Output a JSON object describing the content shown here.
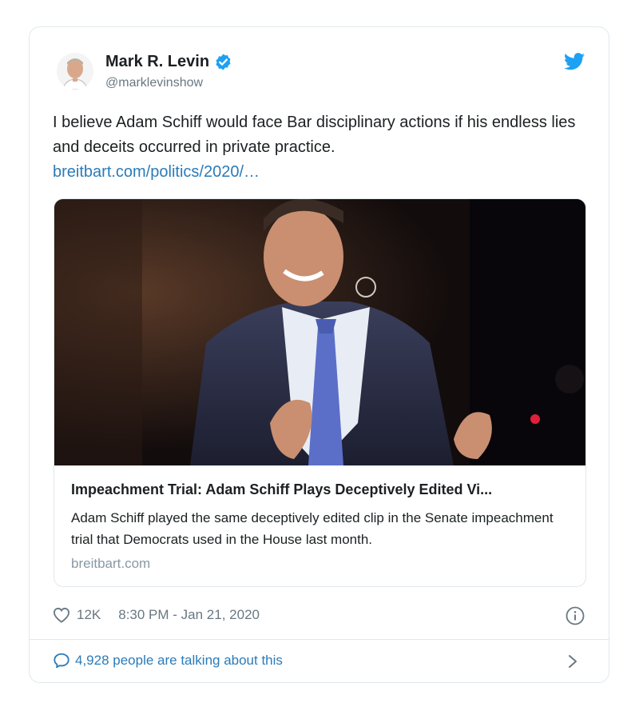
{
  "tweet": {
    "author_name": "Mark R. Levin",
    "author_handle": "@marklevinshow",
    "text": "I believe Adam Schiff would face Bar disciplinary actions if his endless lies and deceits occurred in private practice.",
    "link_text": "breitbart.com/politics/2020/…"
  },
  "card": {
    "title": "Impeachment Trial: Adam Schiff Plays Deceptively Edited Vi...",
    "description": "Adam Schiff played the same deceptively edited clip in the Senate impeachment trial that Democrats used in the House last month.",
    "domain": "breitbart.com"
  },
  "footer": {
    "likes": "12K",
    "timestamp": "8:30 PM - Jan 21, 2020",
    "conversation": "4,928 people are talking about this"
  },
  "icons": {
    "verified": "verified-badge-icon",
    "brand": "twitter-bird-icon",
    "like": "heart-icon",
    "info": "info-icon",
    "reply": "speech-bubble-icon",
    "more": "chevron-right-icon"
  },
  "colors": {
    "accent": "#1da1f2",
    "link": "#2b7bb9",
    "muted": "#697882"
  }
}
